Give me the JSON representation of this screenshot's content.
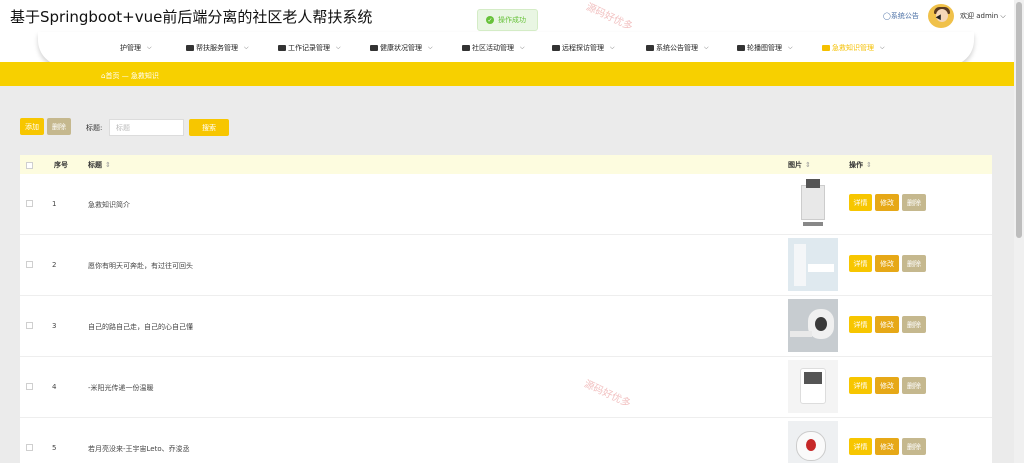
{
  "header": {
    "app_title": "基于Springboot+vue前后端分离的社区老人帮扶系统",
    "toast": "操作成功",
    "notice_link": "系统公告",
    "welcome": "欢迎 admin"
  },
  "nav": {
    "items": [
      {
        "label": "护管理",
        "icon": "user-icon"
      },
      {
        "label": "帮扶服务管理",
        "icon": "home-icon"
      },
      {
        "label": "工作记录管理",
        "icon": "archive-icon"
      },
      {
        "label": "健康状况管理",
        "icon": "monitor-icon"
      },
      {
        "label": "社区活动管理",
        "icon": "calendar-icon"
      },
      {
        "label": "远程探访管理",
        "icon": "video-icon"
      },
      {
        "label": "系统公告管理",
        "icon": "megaphone-icon"
      },
      {
        "label": "轮播图管理",
        "icon": "image-icon"
      },
      {
        "label": "急救知识管理",
        "icon": "firstaid-icon"
      }
    ]
  },
  "breadcrumb": {
    "home": "首页",
    "separator": "—",
    "current": "急救知识"
  },
  "toolbar": {
    "add_label": "添加",
    "delete_label": "删除",
    "search_label": "标题:",
    "search_placeholder": "标题",
    "search_button": "搜索"
  },
  "table": {
    "headers": {
      "index": "序号",
      "title": "标题",
      "image": "图片",
      "actions": "操作"
    },
    "action_labels": {
      "detail": "详情",
      "edit": "修改",
      "delete": "删除"
    },
    "rows": [
      {
        "index": "1",
        "title": "急救知识简介"
      },
      {
        "index": "2",
        "title": "愿你有明天可奔赴，有过往可回头"
      },
      {
        "index": "3",
        "title": "自己的路自己走，自己的心自己懂"
      },
      {
        "index": "4",
        "title": "-米阳光传递一份温暖"
      },
      {
        "index": "5",
        "title": "若月亮没来-王宇宙Leto、乔浚丞"
      }
    ]
  },
  "watermarks": [
    "源码好优多",
    "源码好优多"
  ],
  "colors": {
    "accent": "#f7c600",
    "edit": "#e6a817",
    "delete": "#c5b88e",
    "banner": "#f7d000",
    "success": "#67c23a"
  }
}
